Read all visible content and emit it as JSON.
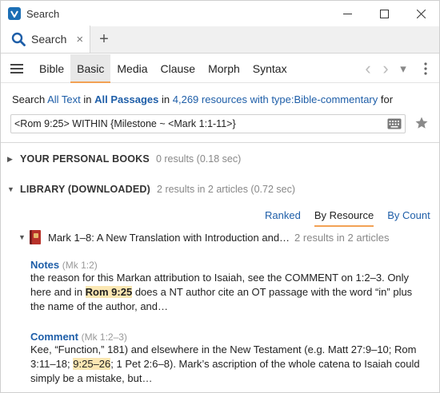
{
  "window": {
    "title": "Search"
  },
  "tabs": [
    {
      "label": "Search",
      "close": "×"
    }
  ],
  "add_tab": "+",
  "toolbar": {
    "modes": [
      "Bible",
      "Basic",
      "Media",
      "Clause",
      "Morph",
      "Syntax"
    ],
    "active_mode": "Basic",
    "back": "‹",
    "forward": "›",
    "dropdown": "▾"
  },
  "search": {
    "prefix": "Search",
    "scope_text": "All Text",
    "in1": "in",
    "passages": "All Passages",
    "in2": "in",
    "resources": "4,269 resources with type:Bible-commentary",
    "suffix": "for",
    "query": "<Rom 9:25> WITHIN {Milestone ~ <Mark 1:1-11>}"
  },
  "sections": [
    {
      "title": "YOUR PERSONAL BOOKS",
      "count": "0 results (0.18 sec)",
      "expanded": false
    },
    {
      "title": "LIBRARY (DOWNLOADED)",
      "count": "2 results in 2 articles (0.72 sec)",
      "expanded": true
    }
  ],
  "sort": {
    "options": [
      "Ranked",
      "By Resource",
      "By Count"
    ],
    "active": "By Resource"
  },
  "resource": {
    "title": "Mark 1–8: A New Translation with Introduction and…",
    "count": "2 results in 2 articles"
  },
  "hits": [
    {
      "label": "Notes",
      "ref": "(Mk 1:2)",
      "line1": "the reason for this Markan attribution to Isaiah, see the COMMENT on 1:2–3. Only",
      "line2_pre": "here and in ",
      "line2_hl": "Rom 9:25",
      "line2_post": " does a NT author cite an OT passage with the word “in” plus",
      "line3": "the name of the author, and…"
    },
    {
      "label": "Comment",
      "ref": "(Mk 1:2–3)",
      "line1": "Kee, “Function,” 181) and elsewhere in the New Testament (e.g. Matt 27:9–10; Rom",
      "line2_pre": "3:11–18; ",
      "line2_hl": "9:25–26",
      "line2_post": "; 1 Pet 2:6–8). Mark’s ascription of the whole catena to Isaiah could",
      "line3": "simply be a mistake, but…"
    }
  ],
  "colors": {
    "link": "#1e5ea8",
    "accent": "#f2a154",
    "highlight": "#fbe7b3"
  }
}
